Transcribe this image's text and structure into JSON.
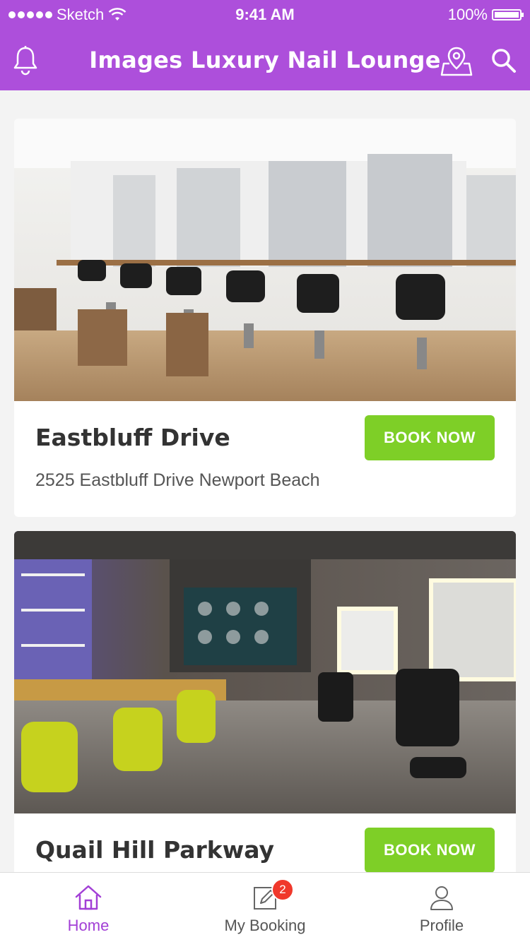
{
  "status_bar": {
    "carrier": "Sketch",
    "time": "9:41 AM",
    "battery": "100%"
  },
  "header": {
    "title": "Images Luxury Nail Lounge"
  },
  "colors": {
    "header": "#ad4fdb",
    "book_button": "#7ecf27",
    "active_tab": "#a23fd6",
    "badge": "#f0382b"
  },
  "locations": [
    {
      "name": "Eastbluff Drive",
      "address": "2525 Eastbluff Drive Newport Beach",
      "button": "BOOK NOW",
      "photo_icon": "salon-interior-photo"
    },
    {
      "name": "Quail Hill Parkway",
      "address": "",
      "button": "BOOK NOW",
      "photo_icon": "salon-interior-photo"
    }
  ],
  "tabs": [
    {
      "label": "Home",
      "icon": "home-icon",
      "active": true
    },
    {
      "label": "My Booking",
      "icon": "edit-icon",
      "badge": "2"
    },
    {
      "label": "Profile",
      "icon": "user-icon"
    }
  ]
}
